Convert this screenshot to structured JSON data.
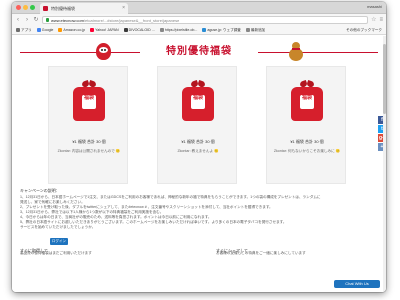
{
  "browser": {
    "tab_title": "特別優待福袋",
    "profile_name": "masashi",
    "url_host": "www.etecnow.com",
    "url_path": "/etcatmore/...#store/japanese&__front_store/japanese",
    "bookmarks": [
      {
        "label": "アプリ",
        "color": "#6e6e6e"
      },
      {
        "label": "Google",
        "color": "#4285f4"
      },
      {
        "label": "Amazon.co.jp",
        "color": "#ff9900"
      },
      {
        "label": "Yahoo! JAPAN",
        "color": "#ff0033"
      },
      {
        "label": "DIVOCALOID ...",
        "color": "#3a3a3a"
      },
      {
        "label": "https://pixelstile.ob...",
        "color": "#888888"
      },
      {
        "label": "aguse.jp: ウェブ調査",
        "color": "#2a8dd4"
      },
      {
        "label": "最新追加",
        "color": "#888888"
      }
    ],
    "other_bookmarks": "その他のブックマーク"
  },
  "header": {
    "title": "特別優待福袋"
  },
  "share": [
    "f",
    "t",
    "g+",
    "+"
  ],
  "cards": [
    {
      "bag_text": "福袋",
      "name": "¥1 福袋 合計 30 個",
      "desc": "Zkontar: 内容は公開されませんので 🙂"
    },
    {
      "bag_text": "福袋",
      "name": "¥1 福袋 合計 30 個",
      "desc": "Zkontar: 教えませんよ 🙂"
    },
    {
      "bag_text": "福袋",
      "name": "¥1 福袋 合計 30 個",
      "desc": "Zkontar: 何もないからこそお楽しみに 🙂"
    }
  ],
  "info": {
    "title": "キャンペーンの説明：",
    "lines": [
      "1、12月31日から、日本語ホームページで1注文、またはGDCSをご利用のお客様であれば、神秘的な新年の福で特典をもらうことができます。1つの袋の構成をプレゼントは、ランダムに",
      "   発送し、家で気軽にお楽しみください。",
      "2、プレゼントを受け取った後、ダブルをtwitterにシェアして、また#etecnow # 、注文番号やスクリーンショットを添付して、当社ポイントを獲得できます。",
      "3、12月31日から、弊社では以下1人様から1つ数が以下の特典福袋をご利用実施を含む。",
      "4、今日からは年の日まで、当商社がの販売のため、送料等を負担されます。ポイントは今日以前にご利用になれます。",
      "5、弊社の日本語サイトにお越しいただきありがとうございます。このホームページをお楽しみいただければ幸いです。より多くの日本の電子タバコを発行させます。",
      "   サービスを始めていただけましたでしょうか。"
    ]
  },
  "actions": {
    "left_label": "すぐに取得して",
    "button_label": "ログイン",
    "left_sub": "高品質の優待福袋はまだご利用いただけます",
    "right_label": "すぐにシェアして",
    "right_sub": "お客様の友達もこの特典をご一緒に楽しみにしています"
  },
  "chat": {
    "label": "Chat With Us"
  }
}
